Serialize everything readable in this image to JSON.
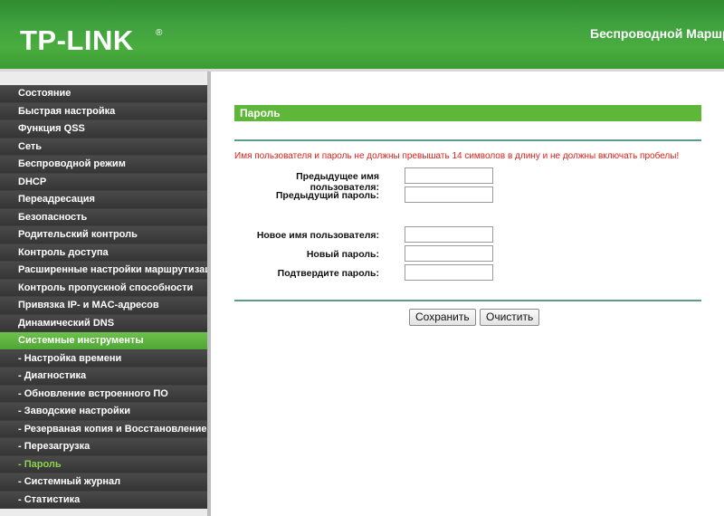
{
  "header": {
    "logo_text": "TP-LINK",
    "logo_mark": "®",
    "title": "Беспроводной Маршрутизатор"
  },
  "sidebar": {
    "items": [
      {
        "label": "Состояние"
      },
      {
        "label": "Быстрая настройка"
      },
      {
        "label": "Функция QSS"
      },
      {
        "label": "Сеть"
      },
      {
        "label": "Беспроводной режим"
      },
      {
        "label": "DHCP"
      },
      {
        "label": "Переадресация"
      },
      {
        "label": "Безопасность"
      },
      {
        "label": "Родительский контроль"
      },
      {
        "label": "Контроль доступа"
      },
      {
        "label": "Расширенные настройки маршрутизации"
      },
      {
        "label": "Контроль пропускной способности"
      },
      {
        "label": "Привязка IP- и MAC-адресов"
      },
      {
        "label": "Динамический DNS"
      },
      {
        "label": "Системные инструменты"
      },
      {
        "label": "- Настройка времени"
      },
      {
        "label": "- Диагностика"
      },
      {
        "label": "- Обновление встроенного ПО"
      },
      {
        "label": "- Заводские настройки"
      },
      {
        "label": "- Резерваная копия и Восстановление"
      },
      {
        "label": "- Перезагрузка"
      },
      {
        "label": "- Пароль"
      },
      {
        "label": "- Системный журнал"
      },
      {
        "label": "- Статистика"
      }
    ]
  },
  "main": {
    "section_title": "Пароль",
    "warning": "Имя пользователя и пароль не должны превышать 14 символов в длину и не должны включать пробелы!",
    "fields": {
      "old_username_label": "Предыдущее имя пользователя:",
      "old_password_label": "Предыдущий пароль:",
      "new_username_label": "Новое имя пользователя:",
      "new_password_label": "Новый пароль:",
      "confirm_password_label": "Подтвердите пароль:",
      "old_username_value": "",
      "old_password_value": "",
      "new_username_value": "",
      "new_password_value": "",
      "confirm_password_value": ""
    },
    "buttons": {
      "save": "Сохранить",
      "clear": "Очистить"
    }
  },
  "colors": {
    "header_green": "#3fa13f",
    "active_menu_green": "#5fb73a",
    "menu_dark": "#414141",
    "selected_submenu_text": "#8fd14f",
    "warning_red": "#e0201a",
    "divider_teal": "#5e9b8f"
  }
}
